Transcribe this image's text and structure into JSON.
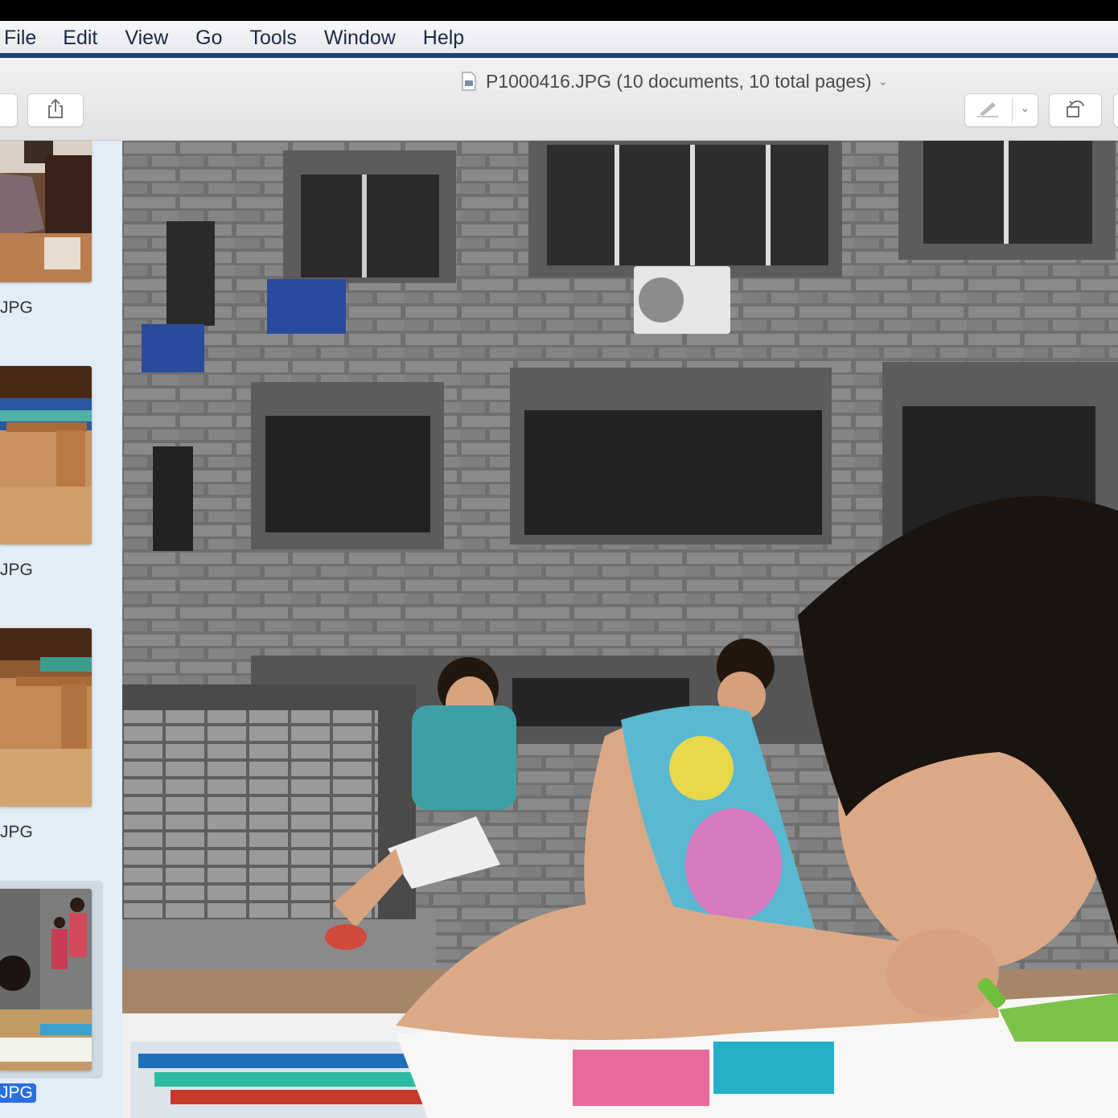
{
  "menu": [
    "File",
    "Edit",
    "View",
    "Go",
    "Tools",
    "Window",
    "Help"
  ],
  "window": {
    "title": "P1000416.JPG (10 documents, 10 total pages)"
  },
  "toolbar": {
    "share_icon": "share-icon",
    "markup_icon": "pen-markup-icon",
    "rotate_icon": "rotate-left-icon"
  },
  "sidebar": {
    "thumbnails": [
      {
        "label": "JPG",
        "selected": false
      },
      {
        "label": "JPG",
        "selected": false
      },
      {
        "label": "JPG",
        "selected": false
      },
      {
        "label": "JPG",
        "selected": true
      }
    ]
  },
  "colors": {
    "menu_rule": "#1c3f74",
    "sidebar_bg": "#e2edf7",
    "selection": "#2a6fe0"
  }
}
